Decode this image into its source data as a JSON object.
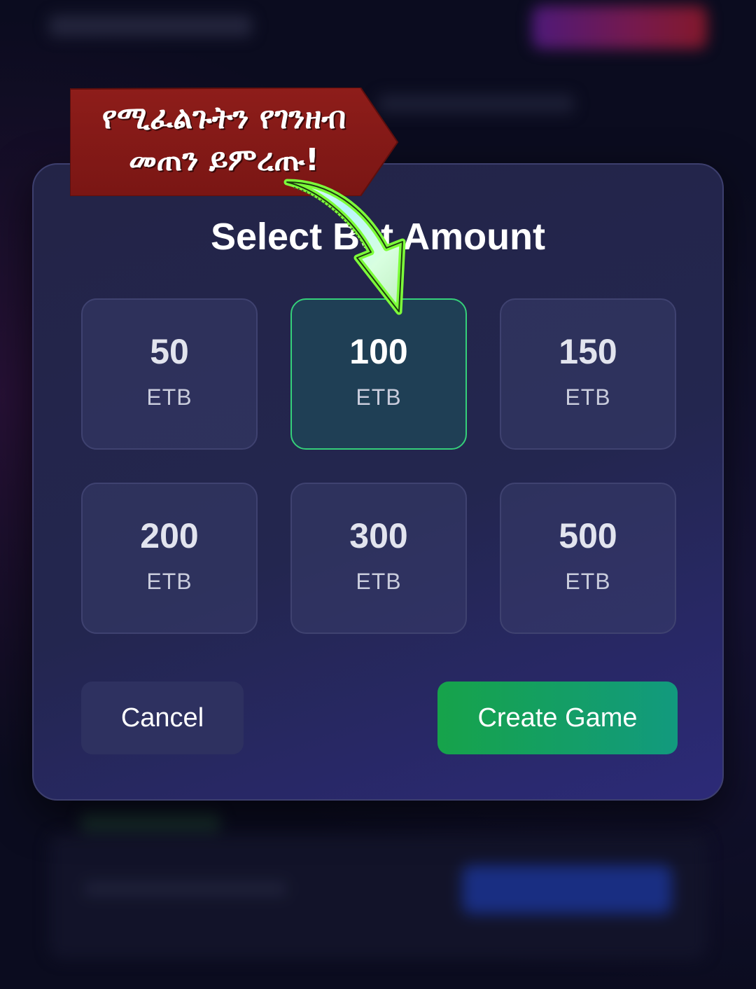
{
  "modal": {
    "title": "Select Bet Amount",
    "options": [
      {
        "value": "50",
        "unit": "ETB",
        "selected": false
      },
      {
        "value": "100",
        "unit": "ETB",
        "selected": true
      },
      {
        "value": "150",
        "unit": "ETB",
        "selected": false
      },
      {
        "value": "200",
        "unit": "ETB",
        "selected": false
      },
      {
        "value": "300",
        "unit": "ETB",
        "selected": false
      },
      {
        "value": "500",
        "unit": "ETB",
        "selected": false
      }
    ],
    "cancel_label": "Cancel",
    "create_label": "Create Game"
  },
  "banner": {
    "line1": "የሚፈልጉትን የገንዘብ",
    "line2": "መጠን ይምረጡ!"
  },
  "colors": {
    "accent_green": "#16a34a",
    "selected_border": "#35d07a",
    "banner_red": "#8b1a1a",
    "arrow_green": "#7dff3a"
  },
  "icons": {
    "pointer": "pointer-arrow-icon"
  }
}
